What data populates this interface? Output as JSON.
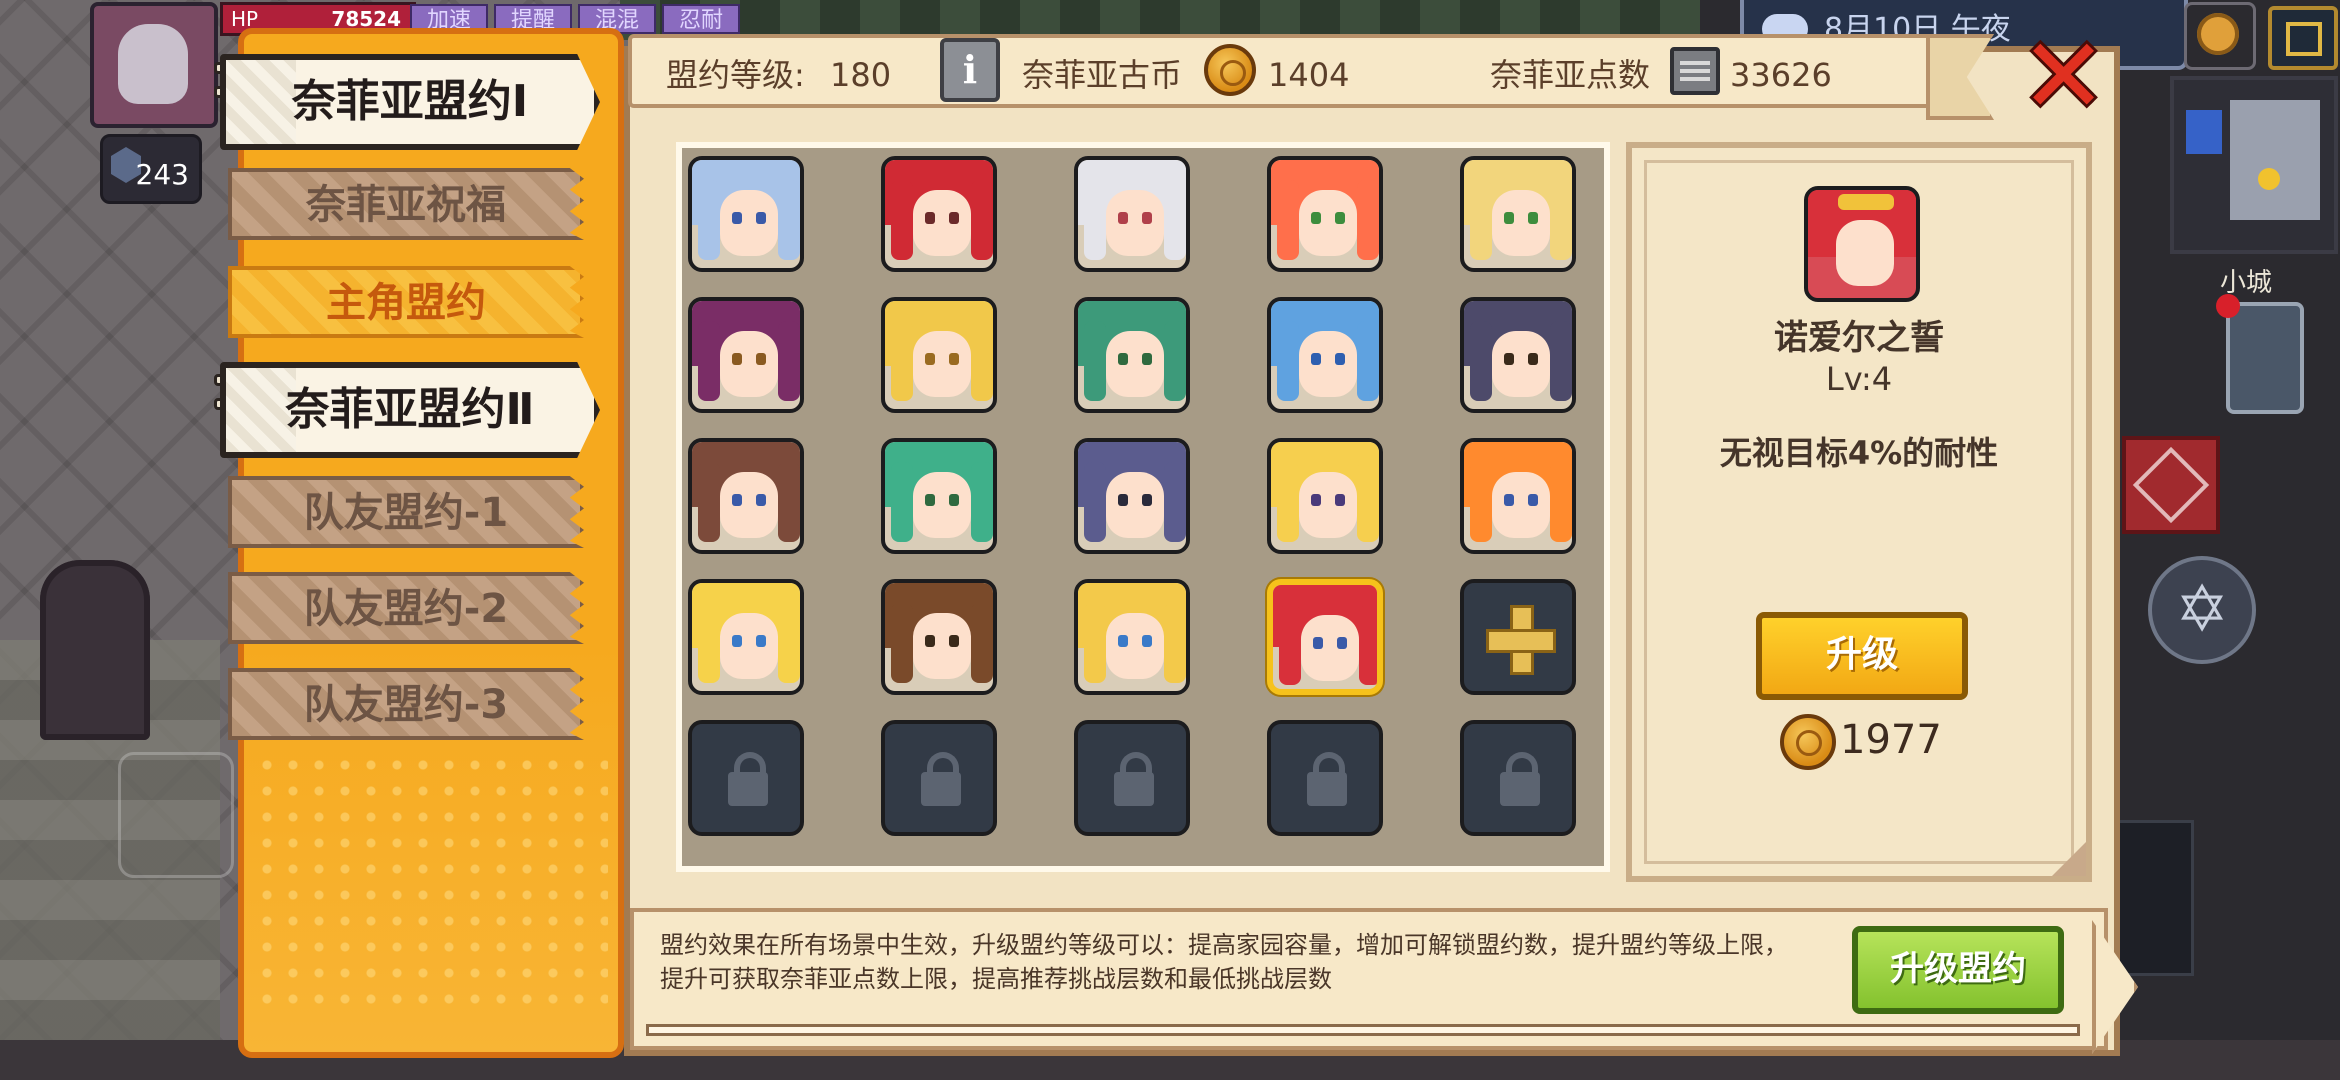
{
  "hud": {
    "hp_label": "HP",
    "hp_value": "78524",
    "level": "243",
    "top_tabs": [
      "加速",
      "提醒",
      "混混",
      "忍耐"
    ],
    "right_bar_text": "8月10日 午夜",
    "minimap_label": "小城"
  },
  "sidebar": {
    "items": [
      {
        "label": "奈菲亚盟约Ⅰ",
        "kind": "header"
      },
      {
        "label": "奈菲亚祝福",
        "kind": "tan"
      },
      {
        "label": "主角盟约",
        "kind": "orange"
      },
      {
        "label": "奈菲亚盟约Ⅱ",
        "kind": "header"
      },
      {
        "label": "队友盟约-1",
        "kind": "tan"
      },
      {
        "label": "队友盟约-2",
        "kind": "tan"
      },
      {
        "label": "队友盟约-3",
        "kind": "tan"
      }
    ]
  },
  "topbar": {
    "pact_level_label": "盟约等级:",
    "pact_level": "180",
    "coins_label": "奈菲亚古币",
    "coins": "1404",
    "points_label": "奈菲亚点数",
    "points": "33626"
  },
  "detail": {
    "name": "诺爱尔之誓",
    "level": "Lv:4",
    "effect": "无视目标4%的耐性",
    "upgrade_label": "升级",
    "cost": "1977"
  },
  "footer": {
    "description_line1": "盟约效果在所有场景中生效，升级盟约等级可以：提高家园容量，增加可解锁盟约数，提升盟约等级上限，",
    "description_line2": "提升可获取奈菲亚点数上限，提高推荐挑战层数和最低挑战层数",
    "upgrade_pact_label": "升级盟约"
  },
  "colors": {
    "accent_orange": "#f6a91e",
    "selected_border": "#f6c21b",
    "close_red": "#e03020",
    "upgrade_green": "#84c22e"
  },
  "icons": {
    "close": "close-x-icon",
    "info": "info-icon",
    "coin": "coin-icon",
    "points": "chip-icon",
    "lock": "lock-icon",
    "add": "plus-icon"
  },
  "grid": {
    "rows": 5,
    "cols": 5,
    "selected_index": 18,
    "slots": [
      {
        "type": "portrait",
        "hair": "#a8c3e8",
        "eye": "#3a5aa8"
      },
      {
        "type": "portrait",
        "hair": "#d02a34",
        "eye": "#6b2a2a"
      },
      {
        "type": "portrait",
        "hair": "#e4e4ea",
        "eye": "#b0404a"
      },
      {
        "type": "portrait",
        "hair": "#ff6f4b",
        "eye": "#3d8d3d"
      },
      {
        "type": "portrait",
        "hair": "#f2d57c",
        "eye": "#3d8d3d"
      },
      {
        "type": "portrait",
        "hair": "#7a2d66",
        "eye": "#8a5a20"
      },
      {
        "type": "portrait",
        "hair": "#f1c84a",
        "eye": "#9a6b20"
      },
      {
        "type": "portrait",
        "hair": "#3d9a7a",
        "eye": "#2f6a3f"
      },
      {
        "type": "portrait",
        "hair": "#5fa2e0",
        "eye": "#2e5fb0"
      },
      {
        "type": "portrait",
        "hair": "#4d4a6a",
        "eye": "#3a2a1a"
      },
      {
        "type": "portrait",
        "hair": "#7c4a3a",
        "eye": "#3a5aa8"
      },
      {
        "type": "portrait",
        "hair": "#3fb08a",
        "eye": "#2f6a3f"
      },
      {
        "type": "portrait",
        "hair": "#5b5c8e",
        "eye": "#2a2a3a"
      },
      {
        "type": "portrait",
        "hair": "#f6cf4e",
        "eye": "#4a3a7a"
      },
      {
        "type": "portrait",
        "hair": "#ff8a2e",
        "eye": "#3a5aa8"
      },
      {
        "type": "portrait",
        "hair": "#f6d24a",
        "eye": "#3a7ac8"
      },
      {
        "type": "portrait",
        "hair": "#7a4a2a",
        "eye": "#3a2a1a"
      },
      {
        "type": "portrait",
        "hair": "#f3c94a",
        "eye": "#3a7ac8"
      },
      {
        "type": "portrait",
        "hair": "#d8303a",
        "eye": "#3a5aa8"
      },
      {
        "type": "plus"
      },
      {
        "type": "locked"
      },
      {
        "type": "locked"
      },
      {
        "type": "locked"
      },
      {
        "type": "locked"
      },
      {
        "type": "locked"
      }
    ]
  }
}
